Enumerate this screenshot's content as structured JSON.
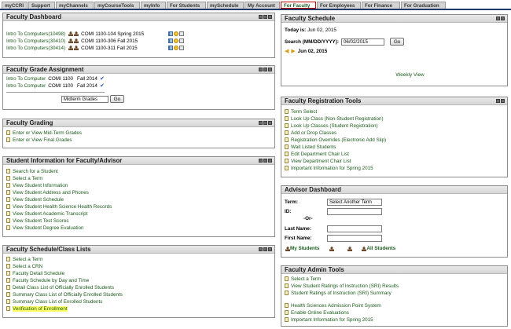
{
  "nav": {
    "tabs": [
      {
        "label": "myCCRI",
        "width": 33
      },
      {
        "label": "Support",
        "width": 34
      },
      {
        "label": "myChannels",
        "width": 48
      },
      {
        "label": "myCourseTools",
        "width": 58
      },
      {
        "label": "myInfo",
        "width": 32
      },
      {
        "label": "For Students",
        "width": 50
      },
      {
        "label": "mySchedule",
        "width": 47
      },
      {
        "label": "My Account",
        "width": 45
      },
      {
        "label": "For Faculty",
        "width": 45,
        "active": true
      },
      {
        "label": "For Employees",
        "width": 56
      },
      {
        "label": "For Finance",
        "width": 49
      },
      {
        "label": "For Graduation",
        "width": 57
      }
    ]
  },
  "faculty_dashboard": {
    "title": "Faculty Dashboard",
    "courses": [
      {
        "title": "Intro To Computers(10498)",
        "info": "COMI 1100-104 Spring 2015"
      },
      {
        "title": "Intro To Computers(30410)",
        "info": "COMI 1100-306 Fall 2015"
      },
      {
        "title": "Intro To Computers(30414)",
        "info": "COMI 1100-311 Fall 2015"
      }
    ]
  },
  "grade_assignment": {
    "title": "Faculty Grade Assignment",
    "rows": [
      {
        "title": "Intro To Computer",
        "course": "COMI 1100",
        "term": "Fall 2014"
      },
      {
        "title": "Intro To Computer",
        "course": "COMI 1100",
        "term": "Fall 2014"
      }
    ],
    "select_value": "Midterm Grades",
    "go_label": "Go"
  },
  "faculty_grading": {
    "title": "Faculty Grading",
    "links": [
      "Enter or View Mid-Term Grades",
      "Enter or View Final Grades"
    ]
  },
  "student_info": {
    "title": "Student Information for Faculty/Advisor",
    "links": [
      "Search for a Student",
      "Select a Term",
      "View Student Information",
      "View Student Address and Phones",
      "View Student Schedule",
      "View Student Health Science Health Records",
      "View Student Academic Transcript",
      "View Student Test Scores",
      "View Student Degree Evaluation"
    ]
  },
  "schedule_lists": {
    "title": "Faculty Schedule/Class Lists",
    "links": [
      "Select a Term",
      "Select a CRN",
      "Faculty Detail Schedule",
      "Faculty Schedule by Day and Time",
      "Detail Class List of Officially Enrolled Students",
      "Summary Class List of Officially Enrolled Students",
      "Summary Class List of Enrolled Students",
      "Verification of Enrollment"
    ]
  },
  "faculty_schedule": {
    "title": "Faculty Schedule",
    "today_label": "Today is:",
    "today_value": "Jun 02, 2015",
    "search_label": "Search (MM/DD/YYYY):",
    "search_value": "06/02/2015",
    "go_label": "Go",
    "date_nav": "Jun 02, 2015",
    "weekly_view": "Weekly View"
  },
  "registration_tools": {
    "title": "Faculty Registration Tools",
    "links": [
      "Term Select",
      "Look Up Class (Non-Student Registration)",
      "Look Up Classes (Student Registration)",
      "Add or Drop Classes",
      "Registration Overrides (Electronic Add Slip)",
      "Wait Listed Students",
      "Edit Department Chair List",
      "View Department Chair List",
      "Important Information for Spring 2015"
    ]
  },
  "advisor_dashboard": {
    "title": "Advisor Dashboard",
    "term_label": "Term:",
    "term_select": "Select Another Term",
    "id_label": "ID:",
    "or_label": "-Or-",
    "last_name_label": "Last Name:",
    "first_name_label": "First Name:",
    "my_students": "My Students",
    "all_students": "All Students"
  },
  "admin_tools": {
    "title": "Faculty Admin Tools",
    "links": [
      "Select a Term",
      "View Student Ratings of Instruction (SRI) Results",
      "Student Ratings of Instruction (SRI) Summary",
      "",
      "Health Sciences Admission Point System",
      "Enable Online Evaluations",
      "Important Information for Spring 2015"
    ]
  }
}
